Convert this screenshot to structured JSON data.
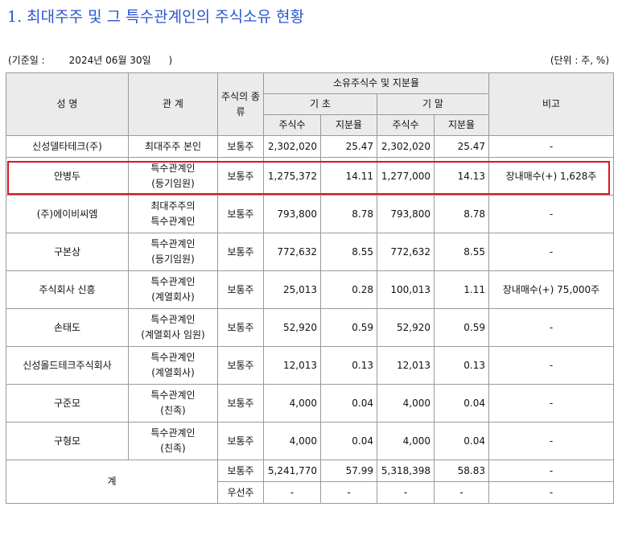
{
  "title": "1. 최대주주 및 그 특수관계인의 주식소유 현황",
  "base_date": {
    "open": "(기준일 :",
    "date": "2024년 06월 30일",
    "close": ")"
  },
  "unit": "(단위 : 주, %)",
  "headers": {
    "name": "성 명",
    "relation": "관 계",
    "stock_type": "주식의 종류",
    "holdings": "소유주식수 및 지분율",
    "begin": "기 초",
    "end": "기 말",
    "shares": "주식수",
    "ratio": "지분율",
    "note": "비고"
  },
  "rows": [
    {
      "name": "신성델타테크(주)",
      "relation": "최대주주 본인",
      "relation2": "",
      "type": "보통주",
      "begin_shares": "2,302,020",
      "begin_ratio": "25.47",
      "end_shares": "2,302,020",
      "end_ratio": "25.47",
      "note": "-"
    },
    {
      "name": "안병두",
      "relation": "특수관계인",
      "relation2": "(등기임원)",
      "type": "보통주",
      "begin_shares": "1,275,372",
      "begin_ratio": "14.11",
      "end_shares": "1,277,000",
      "end_ratio": "14.13",
      "note": "장내매수(+) 1,628주"
    },
    {
      "name": "(주)에이비씨엠",
      "relation": "최대주주의",
      "relation2": "특수관계인",
      "type": "보통주",
      "begin_shares": "793,800",
      "begin_ratio": "8.78",
      "end_shares": "793,800",
      "end_ratio": "8.78",
      "note": "-"
    },
    {
      "name": "구본상",
      "relation": "특수관계인",
      "relation2": "(등기임원)",
      "type": "보통주",
      "begin_shares": "772,632",
      "begin_ratio": "8.55",
      "end_shares": "772,632",
      "end_ratio": "8.55",
      "note": "-"
    },
    {
      "name": "주식회사 신흥",
      "relation": "특수관계인",
      "relation2": "(계열회사)",
      "type": "보통주",
      "begin_shares": "25,013",
      "begin_ratio": "0.28",
      "end_shares": "100,013",
      "end_ratio": "1.11",
      "note": "장내매수(+) 75,000주"
    },
    {
      "name": "손태도",
      "relation": "특수관계인",
      "relation2": "(계열회사 임원)",
      "type": "보통주",
      "begin_shares": "52,920",
      "begin_ratio": "0.59",
      "end_shares": "52,920",
      "end_ratio": "0.59",
      "note": "-"
    },
    {
      "name": "신성몰드테크주식회사",
      "relation": "특수관계인",
      "relation2": "(계열회사)",
      "type": "보통주",
      "begin_shares": "12,013",
      "begin_ratio": "0.13",
      "end_shares": "12,013",
      "end_ratio": "0.13",
      "note": "-"
    },
    {
      "name": "구준모",
      "relation": "특수관계인",
      "relation2": "(친족)",
      "type": "보통주",
      "begin_shares": "4,000",
      "begin_ratio": "0.04",
      "end_shares": "4,000",
      "end_ratio": "0.04",
      "note": "-"
    },
    {
      "name": "구형모",
      "relation": "특수관계인",
      "relation2": "(친족)",
      "type": "보통주",
      "begin_shares": "4,000",
      "begin_ratio": "0.04",
      "end_shares": "4,000",
      "end_ratio": "0.04",
      "note": "-"
    }
  ],
  "total": {
    "label": "계",
    "common": {
      "type": "보통주",
      "begin_shares": "5,241,770",
      "begin_ratio": "57.99",
      "end_shares": "5,318,398",
      "end_ratio": "58.83",
      "note": "-"
    },
    "preferred": {
      "type": "우선주",
      "begin_shares": "-",
      "begin_ratio": "-",
      "end_shares": "-",
      "end_ratio": "-",
      "note": "-"
    }
  },
  "highlight_color": "#e0141e",
  "title_color": "#2a55d6"
}
